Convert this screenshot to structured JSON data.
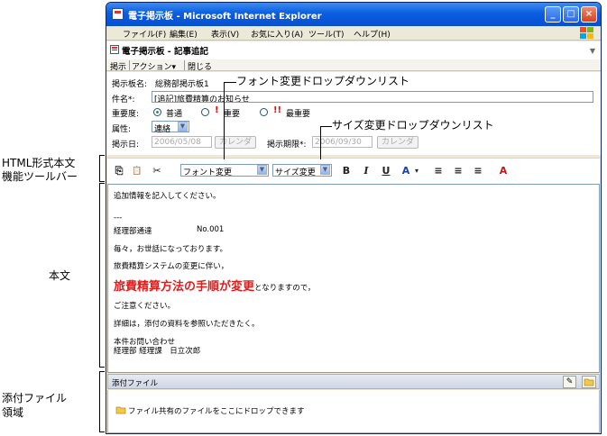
{
  "window": {
    "title": "電子掲示板 - Microsoft Internet Explorer",
    "minimize": "_",
    "maximize": "□",
    "close": "×"
  },
  "menu": {
    "file": "ファイル(F)",
    "edit": "編集(E)",
    "view": "表示(V)",
    "favorites": "お気に入り(A)",
    "tools": "ツール(T)",
    "help": "ヘルプ(H)"
  },
  "app": {
    "title": "電子掲示板 - 記事追記",
    "toolbar": {
      "post": "掲示",
      "action": "アクション▾",
      "close": "閉じる"
    }
  },
  "form": {
    "board_label": "掲示板名:",
    "board_value": "総務部掲示板1",
    "subject_label": "件名*:",
    "subject_value": "[追記]旅費精算のお知らせ",
    "importance_label": "重要度:",
    "importance_normal": "普通",
    "importance_high": "重要",
    "importance_highest": "最重要",
    "attribute_label": "属性:",
    "attribute_value": "連絡",
    "post_date_label": "掲示日:",
    "post_date_value": "2006/05/08",
    "calendar_button": "カレンダ",
    "end_date_label": "掲示期限*:",
    "end_date_value": "2006/09/30"
  },
  "html_toolbar": {
    "copy": "⎘",
    "paste": "📋",
    "cut": "✂",
    "font_select": "フォント変更",
    "size_select": "サイズ変更",
    "bold": "B",
    "italic": "I",
    "underline": "U",
    "color": "A",
    "color_arrow": "▾",
    "align_left": "≡",
    "align_center": "≡",
    "align_right": "≡",
    "spell": "A"
  },
  "body": {
    "line1": "追加情報を記入してください。",
    "line2": "---",
    "line3a": "経理部通達",
    "line3b": "No.001",
    "line4": "毎々，お世話になっております。",
    "line5": "旅費精算システムの変更に伴い，",
    "line6a": "旅費精算方法の手順が変更",
    "line6b": "となりますので，",
    "line7": "ご注意ください。",
    "line8": "詳細は，添付の資料を参照いただきたく。",
    "line9": "本件お問い合わせ",
    "line10": "経理部 経理課　日立次郎"
  },
  "attach": {
    "title": "添付ファイル",
    "clip": "✎",
    "drop": "ファイル共有のファイルをここにドロップできます"
  },
  "annotations": {
    "font_dropdown": "フォント変更ドロップダウンリスト",
    "size_dropdown": "サイズ変更ドロップダウンリスト",
    "toolbar_1": "HTML形式本文",
    "toolbar_2": "機能ツールバー",
    "body": "本文",
    "attach_1": "添付ファイル",
    "attach_2": "領域"
  },
  "colors": {
    "titlebar": "#0a5ee0",
    "emphasis": "#e51a1a",
    "importance": "#e01010"
  }
}
